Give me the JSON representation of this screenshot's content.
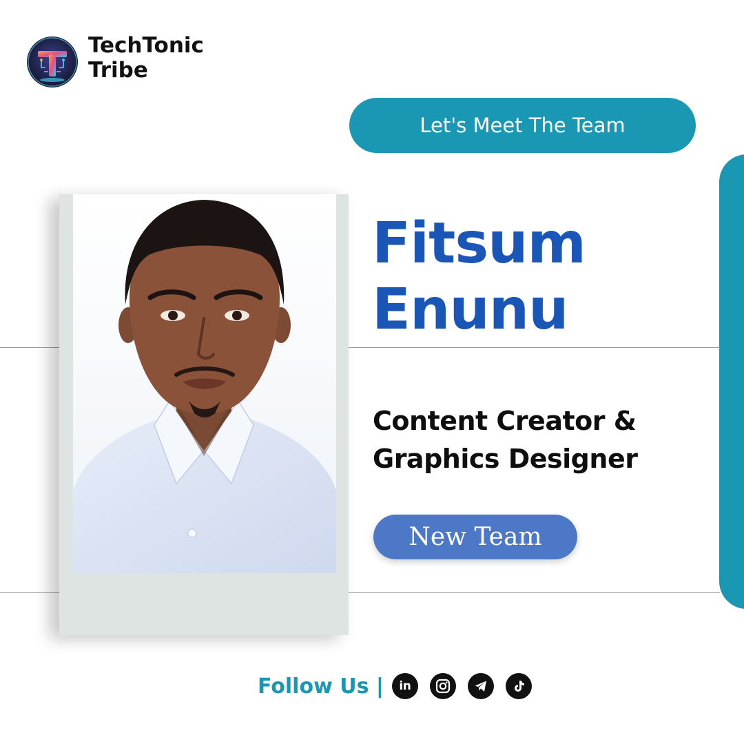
{
  "brand": {
    "line1": "TechTonic",
    "line2": "Tribe",
    "logo_icon": "techtonic-t-logo-icon"
  },
  "header": {
    "pill_label": "Let's Meet The Team"
  },
  "member": {
    "first_name": "Fitsum",
    "last_name": "Enunu",
    "role_line1": "Content Creator &",
    "role_line2": "Graphics Designer",
    "badge": "New Team"
  },
  "footer": {
    "follow_label": "Follow Us |",
    "social": [
      {
        "icon": "linkedin-icon",
        "text": "in"
      },
      {
        "icon": "instagram-icon"
      },
      {
        "icon": "telegram-icon"
      },
      {
        "icon": "tiktok-icon"
      }
    ]
  },
  "colors": {
    "accent_teal": "#1a97b2",
    "name_blue": "#1a55b8",
    "badge_blue": "#4c78c7",
    "text_dark": "#111111"
  }
}
